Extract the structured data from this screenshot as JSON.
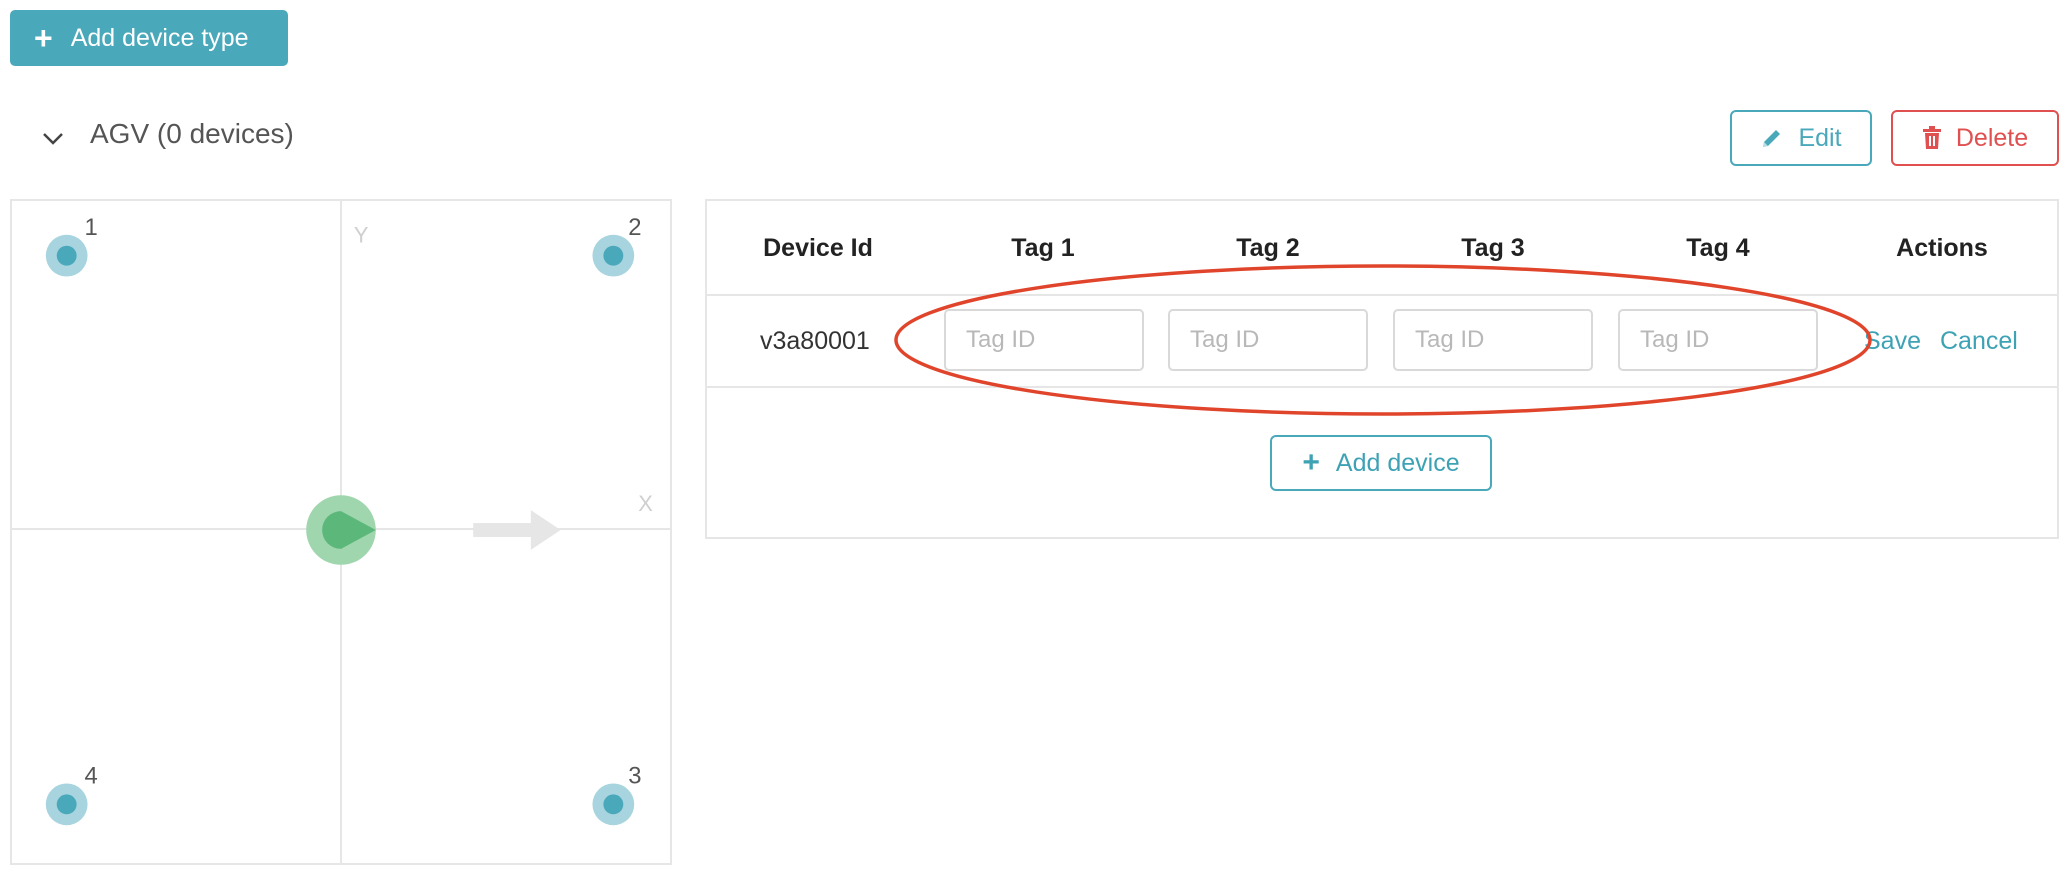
{
  "toolbar": {
    "add_device_type_label": "Add device type"
  },
  "group": {
    "title": "AGV (0 devices)",
    "edit_label": "Edit",
    "delete_label": "Delete"
  },
  "map": {
    "y_label": "Y",
    "x_label": "X",
    "corners": [
      "1",
      "2",
      "3",
      "4"
    ]
  },
  "table": {
    "headers": [
      "Device Id",
      "Tag 1",
      "Tag 2",
      "Tag 3",
      "Tag 4",
      "Actions"
    ],
    "rows": [
      {
        "device_id": "v3a80001",
        "tag_placeholder": "Tag ID",
        "save_label": "Save",
        "cancel_label": "Cancel"
      }
    ],
    "add_device_label": "Add device"
  },
  "colors": {
    "accent": "#4aa8bb",
    "danger": "#e05050",
    "anchor": "#4aa8bb",
    "vehicle": "#5cb87a",
    "highlight": "#e0452c"
  }
}
